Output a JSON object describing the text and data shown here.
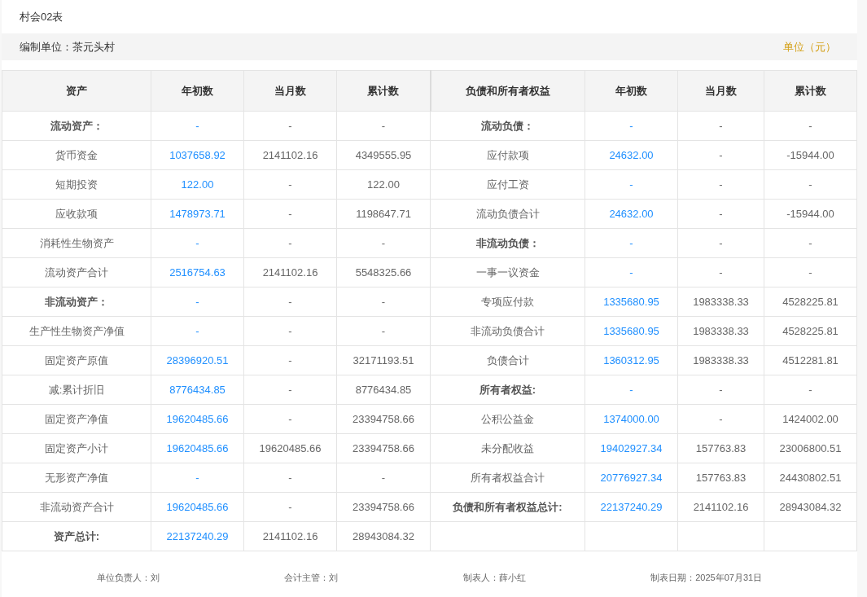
{
  "title": "村会02表",
  "org_bar": {
    "org": "编制单位：茶元头村",
    "unit": "单位（元）"
  },
  "columns": [
    "资产",
    "年初数",
    "当月数",
    "累计数",
    "负债和所有者权益",
    "年初数",
    "当月数",
    "累计数"
  ],
  "rows": [
    {
      "left": {
        "label": "流动资产：",
        "kind": "heading",
        "values": [
          "-",
          "-",
          "-"
        ]
      },
      "right": {
        "label": "流动负债：",
        "kind": "heading",
        "values": [
          "-",
          "-",
          "-"
        ]
      }
    },
    {
      "left": {
        "label": "货币资金",
        "kind": "item",
        "values": [
          "1037658.92",
          "2141102.16",
          "4349555.95"
        ]
      },
      "right": {
        "label": "应付款项",
        "kind": "item",
        "values": [
          "24632.00",
          "-",
          "-15944.00"
        ]
      }
    },
    {
      "left": {
        "label": "短期投资",
        "kind": "item",
        "values": [
          "122.00",
          "-",
          "122.00"
        ]
      },
      "right": {
        "label": "应付工资",
        "kind": "item",
        "values": [
          "-",
          "-",
          "-"
        ]
      }
    },
    {
      "left": {
        "label": "应收款项",
        "kind": "item",
        "values": [
          "1478973.71",
          "-",
          "1198647.71"
        ]
      },
      "right": {
        "label": "流动负债合计",
        "kind": "item",
        "values": [
          "24632.00",
          "-",
          "-15944.00"
        ]
      }
    },
    {
      "left": {
        "label": "消耗性生物资产",
        "kind": "item",
        "values": [
          "-",
          "-",
          "-"
        ]
      },
      "right": {
        "label": "非流动负债：",
        "kind": "heading",
        "values": [
          "-",
          "-",
          "-"
        ]
      }
    },
    {
      "left": {
        "label": "流动资产合计",
        "kind": "item",
        "values": [
          "2516754.63",
          "2141102.16",
          "5548325.66"
        ]
      },
      "right": {
        "label": "一事一议资金",
        "kind": "item",
        "values": [
          "-",
          "-",
          "-"
        ]
      }
    },
    {
      "left": {
        "label": "非流动资产：",
        "kind": "heading",
        "values": [
          "-",
          "-",
          "-"
        ]
      },
      "right": {
        "label": "专项应付款",
        "kind": "item",
        "values": [
          "1335680.95",
          "1983338.33",
          "4528225.81"
        ]
      }
    },
    {
      "left": {
        "label": "生产性生物资产净值",
        "kind": "item",
        "values": [
          "-",
          "-",
          "-"
        ]
      },
      "right": {
        "label": "非流动负债合计",
        "kind": "item",
        "values": [
          "1335680.95",
          "1983338.33",
          "4528225.81"
        ]
      }
    },
    {
      "left": {
        "label": "固定资产原值",
        "kind": "item",
        "values": [
          "28396920.51",
          "-",
          "32171193.51"
        ]
      },
      "right": {
        "label": "负债合计",
        "kind": "item",
        "values": [
          "1360312.95",
          "1983338.33",
          "4512281.81"
        ]
      }
    },
    {
      "left": {
        "label": "减:累计折旧",
        "kind": "item",
        "values": [
          "8776434.85",
          "-",
          "8776434.85"
        ]
      },
      "right": {
        "label": "所有者权益:",
        "kind": "heading",
        "values": [
          "-",
          "-",
          "-"
        ]
      }
    },
    {
      "left": {
        "label": "固定资产净值",
        "kind": "item",
        "values": [
          "19620485.66",
          "-",
          "23394758.66"
        ]
      },
      "right": {
        "label": "公积公益金",
        "kind": "item",
        "values": [
          "1374000.00",
          "-",
          "1424002.00"
        ]
      }
    },
    {
      "left": {
        "label": "固定资产小计",
        "kind": "item",
        "values": [
          "19620485.66",
          "19620485.66",
          "23394758.66"
        ]
      },
      "right": {
        "label": "未分配收益",
        "kind": "item",
        "values": [
          "19402927.34",
          "157763.83",
          "23006800.51"
        ]
      }
    },
    {
      "left": {
        "label": "无形资产净值",
        "kind": "item",
        "values": [
          "-",
          "-",
          "-"
        ]
      },
      "right": {
        "label": "所有者权益合计",
        "kind": "item",
        "values": [
          "20776927.34",
          "157763.83",
          "24430802.51"
        ]
      }
    },
    {
      "left": {
        "label": "非流动资产合计",
        "kind": "item",
        "values": [
          "19620485.66",
          "-",
          "23394758.66"
        ]
      },
      "right": {
        "label": "负债和所有者权益总计:",
        "kind": "heading",
        "values": [
          "22137240.29",
          "2141102.16",
          "28943084.32"
        ]
      }
    },
    {
      "left": {
        "label": "资产总计:",
        "kind": "heading",
        "values": [
          "22137240.29",
          "2141102.16",
          "28943084.32"
        ]
      },
      "right": null
    }
  ],
  "footer": [
    "单位负责人：刘",
    "会计主管：刘",
    "制表人：薛小红",
    "制表日期：2025年07月31日"
  ]
}
